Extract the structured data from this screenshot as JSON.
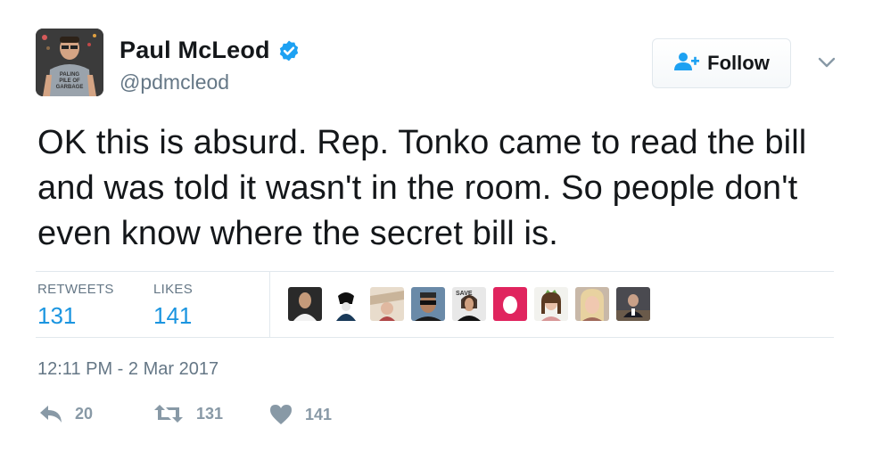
{
  "author": {
    "name": "Paul McLeod",
    "handle": "@pdmcleod",
    "avatar_icon": "avatar-photo",
    "verified_icon": "verified-badge-icon",
    "verified_color": "#1da1f2"
  },
  "follow_button": {
    "label": "Follow",
    "icon": "follow-user-icon",
    "icon_color": "#1da1f2"
  },
  "menu_icon": "chevron-down-icon",
  "tweet": {
    "text": "OK this is absurd. Rep. Tonko came to read the bill and was told it wasn't in the room. So people don't even know where the secret bill is."
  },
  "stats": {
    "retweets_label": "RETWEETS",
    "retweets_value": "131",
    "likes_label": "LIKES",
    "likes_value": "141",
    "value_color": "#1b95e0"
  },
  "likers": [
    {
      "icon": "liker-avatar-1"
    },
    {
      "icon": "liker-avatar-2"
    },
    {
      "icon": "liker-avatar-3"
    },
    {
      "icon": "liker-avatar-4"
    },
    {
      "icon": "liker-avatar-5"
    },
    {
      "icon": "liker-avatar-6-egg"
    },
    {
      "icon": "liker-avatar-7"
    },
    {
      "icon": "liker-avatar-8"
    },
    {
      "icon": "liker-avatar-9"
    }
  ],
  "timestamp": "12:11 PM - 2 Mar 2017",
  "actions": {
    "reply_count": "20",
    "retweet_count": "131",
    "like_count": "141",
    "icon_color": "#8899a6"
  }
}
